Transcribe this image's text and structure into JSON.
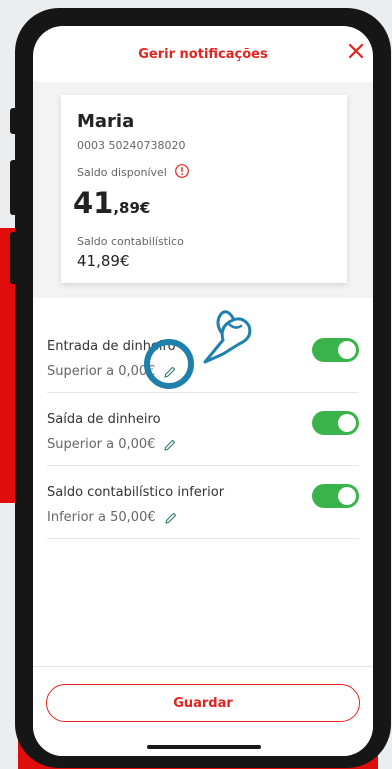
{
  "header": {
    "title": "Gerir notificações",
    "close_icon": "close-icon"
  },
  "account_card": {
    "name": "Maria",
    "account_number": "0003 50240738020",
    "available_label": "Saldo disponível",
    "available_int": "41",
    "available_dec": ",89€",
    "accounting_label": "Saldo contabilístico",
    "accounting_value": "41,89€"
  },
  "notifications": [
    {
      "label": "Entrada de dinheiro",
      "threshold": "Superior a 0,00€",
      "enabled": true
    },
    {
      "label": "Saída de dinheiro",
      "threshold": "Superior a 0,00€",
      "enabled": true
    },
    {
      "label": "Saldo contabilístico inferior",
      "threshold": "Inferior a 50,00€",
      "enabled": true
    }
  ],
  "footer": {
    "save_label": "Guardar"
  },
  "colors": {
    "brand_red": "#e4231e",
    "toggle_on": "#39b34a",
    "tap_hint": "#1f80ab"
  }
}
